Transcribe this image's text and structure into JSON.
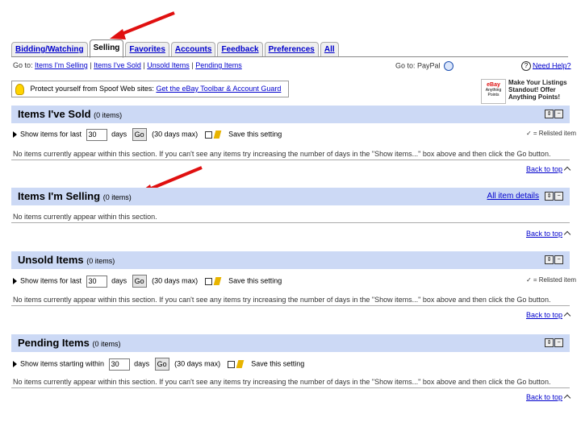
{
  "tabs": [
    {
      "label": "Bidding/Watching"
    },
    {
      "label": "Selling",
      "active": true
    },
    {
      "label": "Favorites"
    },
    {
      "label": "Accounts"
    },
    {
      "label": "Feedback"
    },
    {
      "label": "Preferences"
    },
    {
      "label": "All"
    }
  ],
  "subnav": {
    "goto_label": "Go to:",
    "links": [
      "Items I'm Selling",
      "Items I've Sold",
      "Unsold Items",
      "Pending Items"
    ],
    "separator": "|",
    "right_goto": "Go to: PayPal",
    "help": "Need Help?"
  },
  "spoof": {
    "text": "Protect yourself from Spoof Web sites:",
    "link": "Get the eBay Toolbar & Account Guard"
  },
  "promo": {
    "logo_text": "Anything Points",
    "text": "Make Your Listings Standout! Offer Anything Points!"
  },
  "sections": {
    "sold": {
      "title": "Items I've Sold",
      "count": "(0 items)",
      "show_prefix": "Show items for last",
      "days_value": "30",
      "days_label": "days",
      "go": "Go",
      "max_note": "(30 days max)",
      "save": "Save this setting",
      "relist": "✓ = Relisted item",
      "message": "No items currently appear within this section. If you can't see any items try increasing the number of days in the \"Show items...\" box above and then click the Go button.",
      "back": "Back to top"
    },
    "selling": {
      "title": "Items I'm Selling",
      "count": "(0 items)",
      "all_details": "All item details",
      "message": "No items currently appear within this section.",
      "back": "Back to top"
    },
    "unsold": {
      "title": "Unsold Items",
      "count": "(0 items)",
      "show_prefix": "Show items for last",
      "days_value": "30",
      "days_label": "days",
      "go": "Go",
      "max_note": "(30 days max)",
      "save": "Save this setting",
      "relist": "✓ = Relisted item",
      "message": "No items currently appear within this section. If you can't see any items try increasing the number of days in the \"Show items...\" box above and then click the Go button.",
      "back": "Back to top"
    },
    "pending": {
      "title": "Pending Items",
      "count": "(0 items)",
      "show_prefix": "Show items starting within",
      "days_value": "30",
      "days_label": "days",
      "go": "Go",
      "max_note": "(30 days max)",
      "save": "Save this setting",
      "message": "No items currently appear within this section. If you can't see any items try increasing the number of days in the \"Show items...\" box above and then click the Go button.",
      "back": "Back to top"
    }
  },
  "colors": {
    "section_header": "#ccd9f5",
    "link": "#0000cc",
    "arrow": "#e01010"
  }
}
